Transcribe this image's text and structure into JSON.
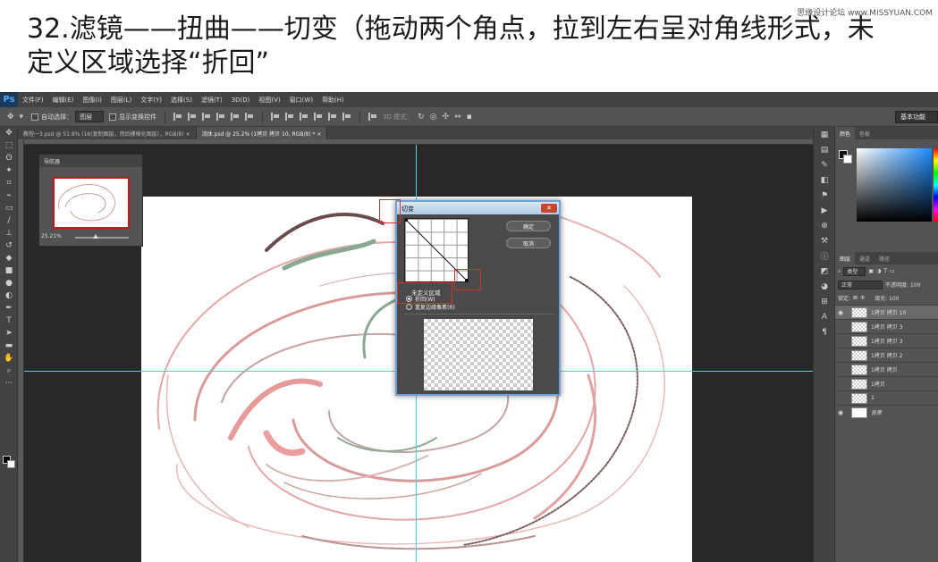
{
  "caption": {
    "text": "32.滤镜——扭曲——切变（拖动两个角点，拉到左右呈对角线形式，未定义区域选择“折回”",
    "watermark": "思缘设计论坛 www.MISSYUAN.COM"
  },
  "app": {
    "logo": "Ps",
    "menu": [
      "文件(F)",
      "编辑(E)",
      "图像(I)",
      "图层(L)",
      "文字(Y)",
      "选择(S)",
      "滤镜(T)",
      "3D(D)",
      "视图(V)",
      "窗口(W)",
      "帮助(H)"
    ]
  },
  "options_bar": {
    "auto_select_label": "自动选择：",
    "auto_select_value": "图层",
    "transform_controls_label": "显示变换控件",
    "mode_3d_label": "3D 模式：",
    "workspace": "基本功能"
  },
  "tabs": [
    {
      "label": "教程一3.psd @ 51.8% (16(复制图层，然后栅格化图层），RGB/8) ×",
      "active": false
    },
    {
      "label": "流体.psd @ 25.2% (1拷贝 拷贝 10, RGB/8) * ×",
      "active": true
    }
  ],
  "navigator": {
    "title": "导航器",
    "zoom": "25.21%"
  },
  "shear_dialog": {
    "title": "切变",
    "ok_label": "确定",
    "cancel_label": "取消",
    "undefined_area_label": "未定义区域",
    "options": [
      {
        "label": "折回(W)",
        "selected": true
      },
      {
        "label": "重复边缘像素(R)",
        "selected": false
      }
    ]
  },
  "color_panel": {
    "tabs": [
      "颜色",
      "色板"
    ]
  },
  "layers_panel": {
    "tabs": [
      "图层",
      "通道",
      "路径"
    ],
    "kind_label": "类型",
    "blend_mode": "正常",
    "opacity_label": "不透明度: 100",
    "lock_label": "锁定:",
    "fill_label": "填充: 100",
    "layers": [
      {
        "name": "1拷贝 拷贝 10",
        "visible": true,
        "selected": true,
        "thumb": "checker"
      },
      {
        "name": "1拷贝 拷贝 3",
        "visible": false,
        "selected": false,
        "thumb": "checker"
      },
      {
        "name": "1拷贝 拷贝 3",
        "visible": false,
        "selected": false,
        "thumb": "checker"
      },
      {
        "name": "1拷贝 拷贝 2",
        "visible": false,
        "selected": false,
        "thumb": "checker"
      },
      {
        "name": "1拷贝 拷贝",
        "visible": false,
        "selected": false,
        "thumb": "checker"
      },
      {
        "name": "1拷贝",
        "visible": false,
        "selected": false,
        "thumb": "checker"
      },
      {
        "name": "1",
        "visible": false,
        "selected": false,
        "thumb": "checker"
      },
      {
        "name": "背景",
        "visible": true,
        "selected": false,
        "thumb": "white",
        "italic": true
      }
    ]
  },
  "colors": {
    "guide": "#3fd7e6",
    "highlight": "#d8322f",
    "swirl_pink": "#e08a8a",
    "swirl_green": "#7fa58c"
  }
}
